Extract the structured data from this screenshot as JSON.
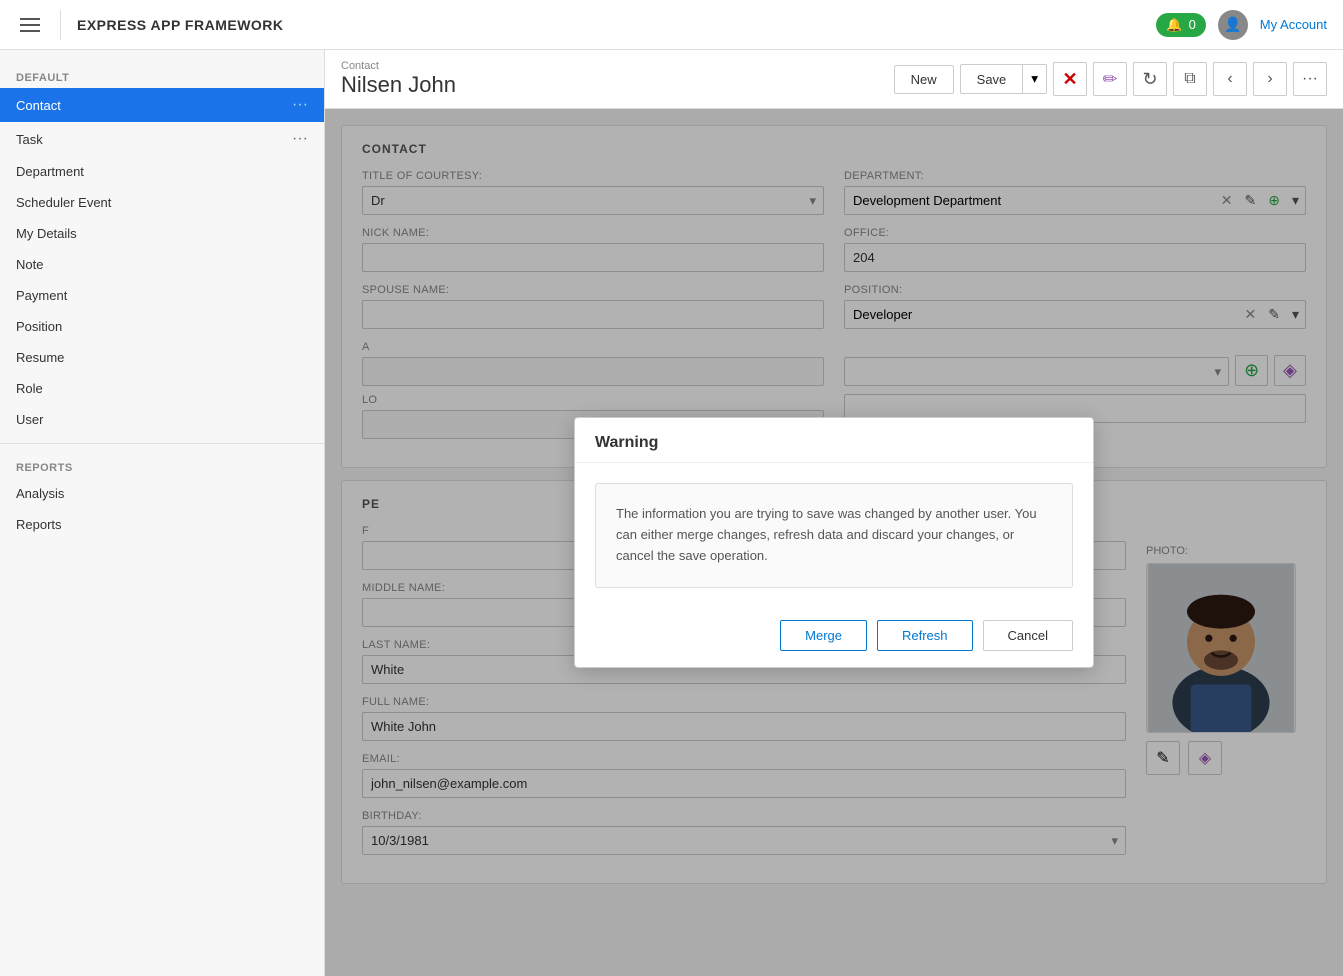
{
  "app": {
    "title": "EXPRESS APP FRAMEWORK",
    "my_account_label": "My Account",
    "notification_count": "0"
  },
  "sidebar": {
    "default_label": "DEFAULT",
    "reports_label": "REPORTS",
    "items": [
      {
        "id": "contact",
        "label": "Contact",
        "active": true,
        "has_dots": true
      },
      {
        "id": "task",
        "label": "Task",
        "active": false,
        "has_dots": true
      },
      {
        "id": "department",
        "label": "Department",
        "active": false,
        "has_dots": false
      },
      {
        "id": "scheduler-event",
        "label": "Scheduler Event",
        "active": false,
        "has_dots": false
      },
      {
        "id": "my-details",
        "label": "My Details",
        "active": false,
        "has_dots": false
      },
      {
        "id": "note",
        "label": "Note",
        "active": false,
        "has_dots": false
      },
      {
        "id": "payment",
        "label": "Payment",
        "active": false,
        "has_dots": false
      },
      {
        "id": "position",
        "label": "Position",
        "active": false,
        "has_dots": false
      },
      {
        "id": "resume",
        "label": "Resume",
        "active": false,
        "has_dots": false
      },
      {
        "id": "role",
        "label": "Role",
        "active": false,
        "has_dots": false
      },
      {
        "id": "user",
        "label": "User",
        "active": false,
        "has_dots": false
      }
    ],
    "report_items": [
      {
        "id": "analysis",
        "label": "Analysis"
      },
      {
        "id": "reports",
        "label": "Reports"
      }
    ]
  },
  "toolbar": {
    "record_type": "Contact",
    "record_name": "Nilsen John",
    "new_label": "New",
    "save_label": "Save",
    "buttons": {
      "delete": "✕",
      "erase": "◈",
      "refresh": "↻",
      "copy": "⧉",
      "prev": "‹",
      "next": "›",
      "more": "…"
    }
  },
  "form": {
    "section_title": "CONTACT",
    "fields": {
      "title_of_courtesy_label": "TITLE OF COURTESY:",
      "title_of_courtesy_value": "Dr",
      "department_label": "DEPARTMENT:",
      "department_value": "Development Department",
      "nick_name_label": "NICK NAME:",
      "nick_name_value": "",
      "office_label": "OFFICE:",
      "office_value": "204",
      "spouse_name_label": "SPOUSE NAME:",
      "spouse_name_value": "",
      "position_label": "POSITION:",
      "position_value": "Developer",
      "address_label": "A",
      "local_label": "LO",
      "photo_label": "PHOTO:",
      "first_name_label": "F",
      "middle_name_label": "MIDDLE NAME:",
      "middle_name_value": "",
      "last_name_label": "LAST NAME:",
      "last_name_value": "White",
      "full_name_label": "FULL NAME:",
      "full_name_value": "White John",
      "email_label": "EMAIL:",
      "email_value": "john_nilsen@example.com",
      "birthday_label": "BIRTHDAY:",
      "birthday_value": "10/3/1981"
    }
  },
  "modal": {
    "title": "Warning",
    "message": "The information you are trying to save was changed by another user. You can either merge changes, refresh data and discard your changes, or cancel the save operation.",
    "merge_label": "Merge",
    "refresh_label": "Refresh",
    "cancel_label": "Cancel"
  }
}
